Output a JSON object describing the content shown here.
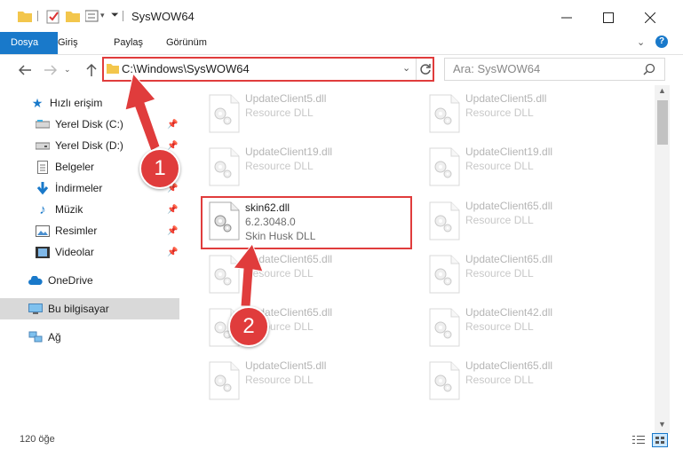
{
  "window": {
    "title": "SysWOW64",
    "controls": [
      "minimize-icon",
      "maximize-icon",
      "close-icon"
    ]
  },
  "ribbon": {
    "tabs": [
      {
        "label": "Dosya"
      },
      {
        "label": "Giriş"
      },
      {
        "label": "Paylaş"
      },
      {
        "label": "Görünüm"
      }
    ],
    "help_icon": "question-icon"
  },
  "address": {
    "path": "C:\\Windows\\SysWOW64",
    "search_placeholder": "Ara: SysWOW64"
  },
  "sidebar": {
    "quick_access": "Hızlı erişim",
    "pinned": [
      {
        "label": "Yerel Disk (C:)",
        "icon": "drive-icon"
      },
      {
        "label": "Yerel Disk (D:)",
        "icon": "drive-icon"
      },
      {
        "label": "Belgeler",
        "icon": "documents-icon"
      },
      {
        "label": "İndirmeler",
        "icon": "download-icon"
      },
      {
        "label": "Müzik",
        "icon": "music-icon"
      },
      {
        "label": "Resimler",
        "icon": "pictures-icon"
      },
      {
        "label": "Videolar",
        "icon": "videos-icon"
      }
    ],
    "onedrive": "OneDrive",
    "this_pc": "Bu bilgisayar",
    "network": "Ağ"
  },
  "files": {
    "left": [
      {
        "name": "UpdateClient5.dll",
        "type": "Resource DLL"
      },
      {
        "name": "UpdateClient19.dll",
        "type": "Resource DLL"
      },
      {
        "name": "skin62.dll",
        "version": "6.2.3048.0",
        "type": "Skin Husk DLL"
      },
      {
        "name": "UpdateClient65.dll",
        "type": "Resource DLL"
      },
      {
        "name": "UpdateClient65.dll",
        "type": "Resource DLL"
      },
      {
        "name": "UpdateClient5.dll",
        "type": "Resource DLL"
      }
    ],
    "right": [
      {
        "name": "UpdateClient5.dll",
        "type": "Resource DLL"
      },
      {
        "name": "UpdateClient19.dll",
        "type": "Resource DLL"
      },
      {
        "name": "UpdateClient65.dll",
        "type": "Resource DLL"
      },
      {
        "name": "UpdateClient65.dll",
        "type": "Resource DLL"
      },
      {
        "name": "UpdateClient42.dll",
        "type": "Resource DLL"
      },
      {
        "name": "UpdateClient65.dll",
        "type": "Resource DLL"
      }
    ]
  },
  "status": {
    "item_count": "120 öğe"
  },
  "annotations": {
    "step1": "1",
    "step2": "2",
    "color": "#e03c3c"
  }
}
